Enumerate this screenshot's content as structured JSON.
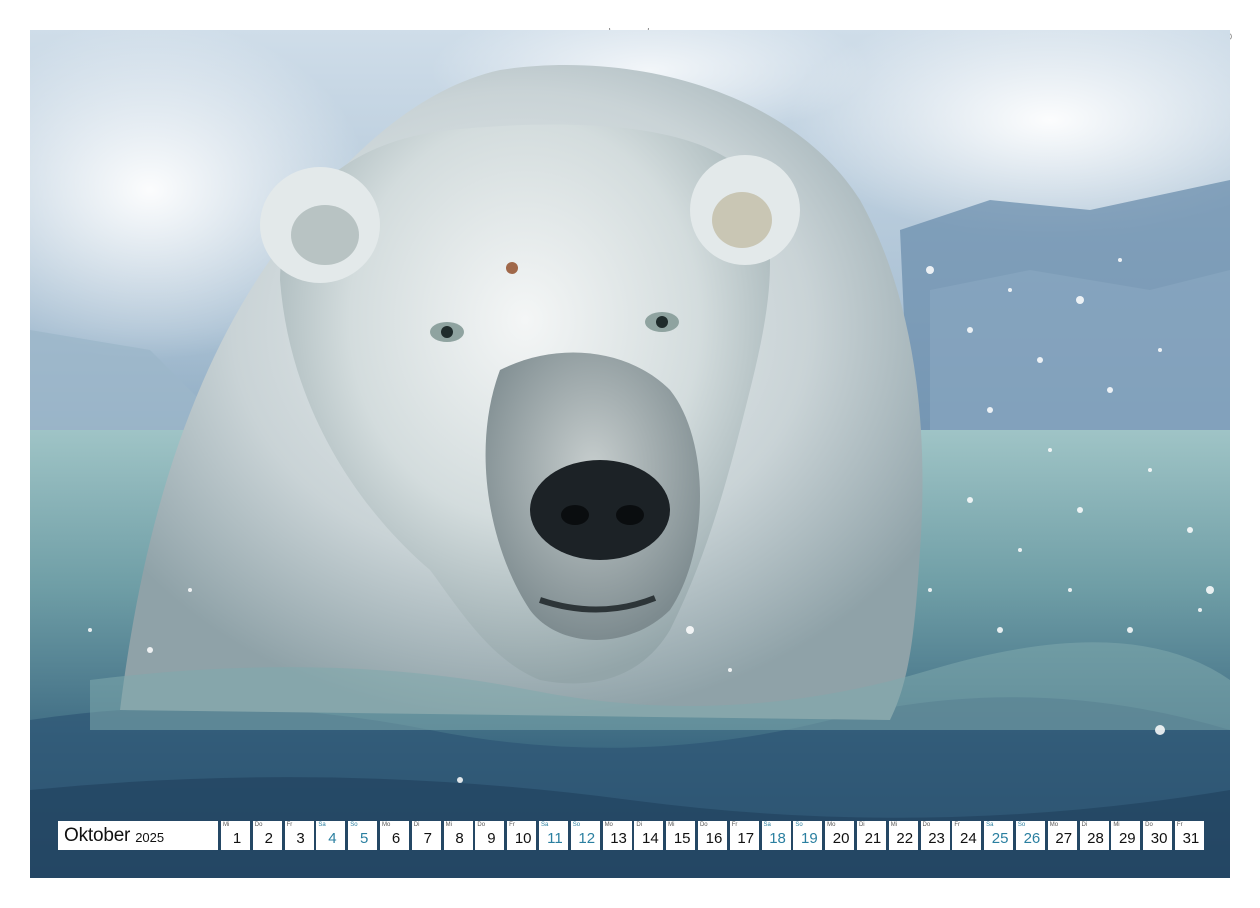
{
  "calendar": {
    "month": "Oktober",
    "year": "2025",
    "accent_color": "#2a7fa0",
    "days": [
      {
        "wd": "Mi",
        "num": "1"
      },
      {
        "wd": "Do",
        "num": "2"
      },
      {
        "wd": "Fr",
        "num": "3"
      },
      {
        "wd": "Sa",
        "num": "4",
        "weekend": true
      },
      {
        "wd": "So",
        "num": "5",
        "weekend": true
      },
      {
        "wd": "Mo",
        "num": "6"
      },
      {
        "wd": "Di",
        "num": "7"
      },
      {
        "wd": "Mi",
        "num": "8"
      },
      {
        "wd": "Do",
        "num": "9"
      },
      {
        "wd": "Fr",
        "num": "10"
      },
      {
        "wd": "Sa",
        "num": "11",
        "weekend": true
      },
      {
        "wd": "So",
        "num": "12",
        "weekend": true
      },
      {
        "wd": "Mo",
        "num": "13"
      },
      {
        "wd": "Di",
        "num": "14"
      },
      {
        "wd": "Mi",
        "num": "15"
      },
      {
        "wd": "Do",
        "num": "16"
      },
      {
        "wd": "Fr",
        "num": "17"
      },
      {
        "wd": "Sa",
        "num": "18",
        "weekend": true
      },
      {
        "wd": "So",
        "num": "19",
        "weekend": true
      },
      {
        "wd": "Mo",
        "num": "20"
      },
      {
        "wd": "Di",
        "num": "21"
      },
      {
        "wd": "Mi",
        "num": "22"
      },
      {
        "wd": "Do",
        "num": "23"
      },
      {
        "wd": "Fr",
        "num": "24"
      },
      {
        "wd": "Sa",
        "num": "25",
        "weekend": true
      },
      {
        "wd": "So",
        "num": "26",
        "weekend": true
      },
      {
        "wd": "Mo",
        "num": "27"
      },
      {
        "wd": "Di",
        "num": "28"
      },
      {
        "wd": "Mi",
        "num": "29"
      },
      {
        "wd": "Do",
        "num": "30"
      },
      {
        "wd": "Fr",
        "num": "31"
      }
    ]
  }
}
